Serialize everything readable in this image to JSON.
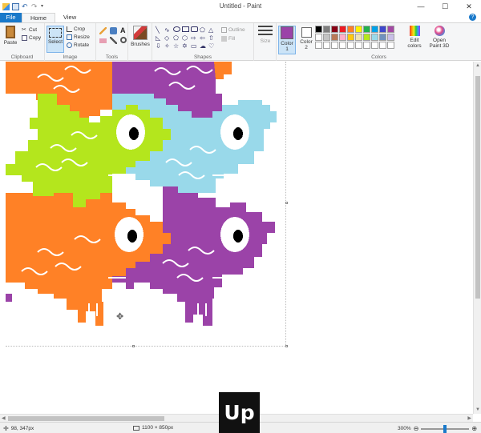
{
  "window": {
    "title": "Untitled - Paint",
    "minimize": "—",
    "maximize": "☐",
    "close": "✕"
  },
  "tabs": [
    {
      "label": "File"
    },
    {
      "label": "Home"
    },
    {
      "label": "View"
    }
  ],
  "help_icon": "?",
  "ribbon": {
    "clipboard": {
      "label": "Clipboard",
      "paste": "Paste",
      "cut": "Cut",
      "copy": "Copy"
    },
    "image": {
      "label": "Image",
      "select": "Select",
      "crop": "Crop",
      "resize": "Resize",
      "rotate": "Rotate"
    },
    "tools": {
      "label": "Tools"
    },
    "brushes": {
      "label": "Brushes"
    },
    "shapes": {
      "label": "Shapes",
      "outline": "Outline",
      "fill": "Fill"
    },
    "size": {
      "label": "Size"
    },
    "colors": {
      "label": "Colors",
      "color1": "Color 1",
      "color2": "Color 2",
      "edit_colors": "Edit colors",
      "open_paint3d": "Open Paint 3D",
      "color1_value": "#9b43a8",
      "color2_value": "#ffffff",
      "palette": [
        "#000000",
        "#7f7f7f",
        "#880015",
        "#ed1c24",
        "#ff7f27",
        "#fff200",
        "#22b14c",
        "#00a2e8",
        "#3f48cc",
        "#a349a4",
        "#ffffff",
        "#c3c3c3",
        "#b97a57",
        "#ffaec9",
        "#ffc90e",
        "#efe4b0",
        "#b5e61d",
        "#99d9ea",
        "#7092be",
        "#c8bfe7",
        "#ffffff",
        "#ffffff",
        "#ffffff",
        "#ffffff",
        "#ffffff",
        "#ffffff",
        "#ffffff",
        "#ffffff",
        "#ffffff",
        "#ffffff"
      ]
    }
  },
  "artwork_colors": {
    "orange": "#ff8126",
    "purple": "#9b43a8",
    "green": "#b4e61d",
    "blue": "#99d9ea",
    "white": "#ffffff",
    "black": "#000000"
  },
  "status": {
    "cursor_pos": "98, 347px",
    "canvas_size": "1100 × 850px",
    "zoom": "300%"
  },
  "badge": {
    "text": "Up"
  }
}
